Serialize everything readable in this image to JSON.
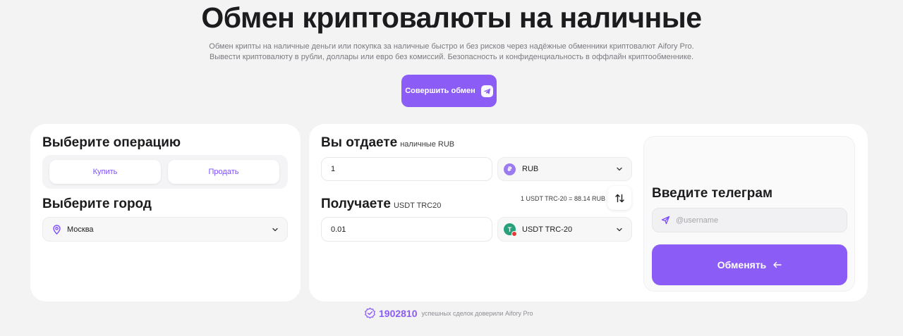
{
  "hero": {
    "title": "Обмен криптовалюты на наличные",
    "subtitle_line1": "Обмен крипты на наличные деньги или покупка за наличные быстро и без рисков через надёжные обменники криптовалют Aifory Pro.",
    "subtitle_line2": "Вывести криптовалюту в рубли, доллары или евро без комиссий. Безопасность и конфиденциальность в оффлайн криптообменнике.",
    "cta_label": "Совершить обмен",
    "cta_icon": "telegram-icon"
  },
  "operation": {
    "title": "Выберите операцию",
    "buy_label": "Купить",
    "sell_label": "Продать"
  },
  "city": {
    "title": "Выберите город",
    "selected": "Москва",
    "icon": "location-pin-icon"
  },
  "give": {
    "title": "Вы отдаете",
    "subtitle": "наличные RUB",
    "amount": "1",
    "currency": "RUB"
  },
  "receive": {
    "title": "Получаете",
    "subtitle": "USDT TRC20",
    "amount": "0.01",
    "currency": "USDT TRC-20"
  },
  "rate_text": "1 USDT TRC-20 = 88.14 RUB",
  "telegram": {
    "title": "Введите телеграм",
    "placeholder": "@username",
    "submit_label": "Обменять"
  },
  "footer": {
    "count": "1902810",
    "text": "успешных сделок доверили Aifory Pro"
  },
  "colors": {
    "accent": "#8b5cf6",
    "background": "#f3f3f4",
    "card": "#ffffff",
    "rub_coin": "#9b7cf0",
    "usdt_coin": "#26a17b"
  }
}
